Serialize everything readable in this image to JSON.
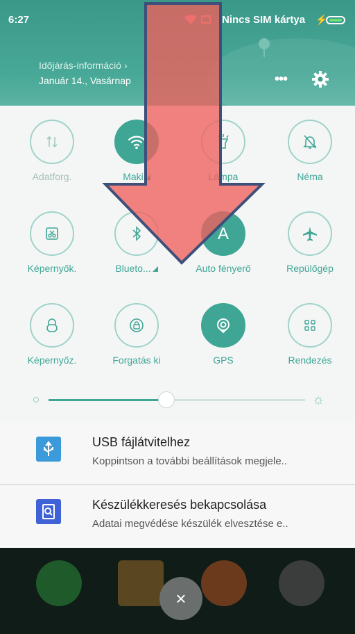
{
  "status_bar": {
    "time": "6:27",
    "carrier": "Nincs SIM kártya",
    "bolt": "⚡"
  },
  "weather": {
    "title": "Időjárás-információ",
    "chevron": "›",
    "date": "Január 14., Vasárnap"
  },
  "header": {
    "more_label": "•••",
    "settings_icon": "gear-icon"
  },
  "tiles": [
    {
      "label": "Adatforg.",
      "icon": "data-transfer-icon",
      "active": false
    },
    {
      "label": "Maki",
      "icon": "wifi-icon",
      "active": true
    },
    {
      "label": "Lámpa",
      "icon": "flashlight-icon",
      "active": false
    },
    {
      "label": "Néma",
      "icon": "bell-off-icon",
      "active": false
    },
    {
      "label": "Képernyők.",
      "icon": "screenshot-icon",
      "active": false
    },
    {
      "label": "Blueto...",
      "icon": "bluetooth-icon",
      "active": false
    },
    {
      "label": "Auto fényerő",
      "icon": "auto-brightness-icon",
      "active": true,
      "glyph": "A"
    },
    {
      "label": "Repülőgép",
      "icon": "airplane-icon",
      "active": false
    },
    {
      "label": "Képernyőz.",
      "icon": "lock-icon",
      "active": false
    },
    {
      "label": "Forgatás ki",
      "icon": "rotation-lock-icon",
      "active": false
    },
    {
      "label": "GPS",
      "icon": "gps-icon",
      "active": true
    },
    {
      "label": "Rendezés",
      "icon": "grid-icon",
      "active": false
    }
  ],
  "brightness": {
    "level": 0.46,
    "high_icon": "☼"
  },
  "notifications": [
    {
      "title": "USB fájlátvitelhez",
      "text": "Koppintson a további beállítások megjele..",
      "icon": "usb-icon",
      "color": "#3b9ad9"
    },
    {
      "title": "Készülékkeresés bekapcsolása",
      "text": "Adatai megvédése készülék elvesztése e..",
      "icon": "find-device-icon",
      "color": "#3f63d6"
    }
  ],
  "close_label": "×",
  "colors": {
    "accent": "#3fa695",
    "header": "#3f9b8c",
    "arrow": "#f07a74"
  }
}
